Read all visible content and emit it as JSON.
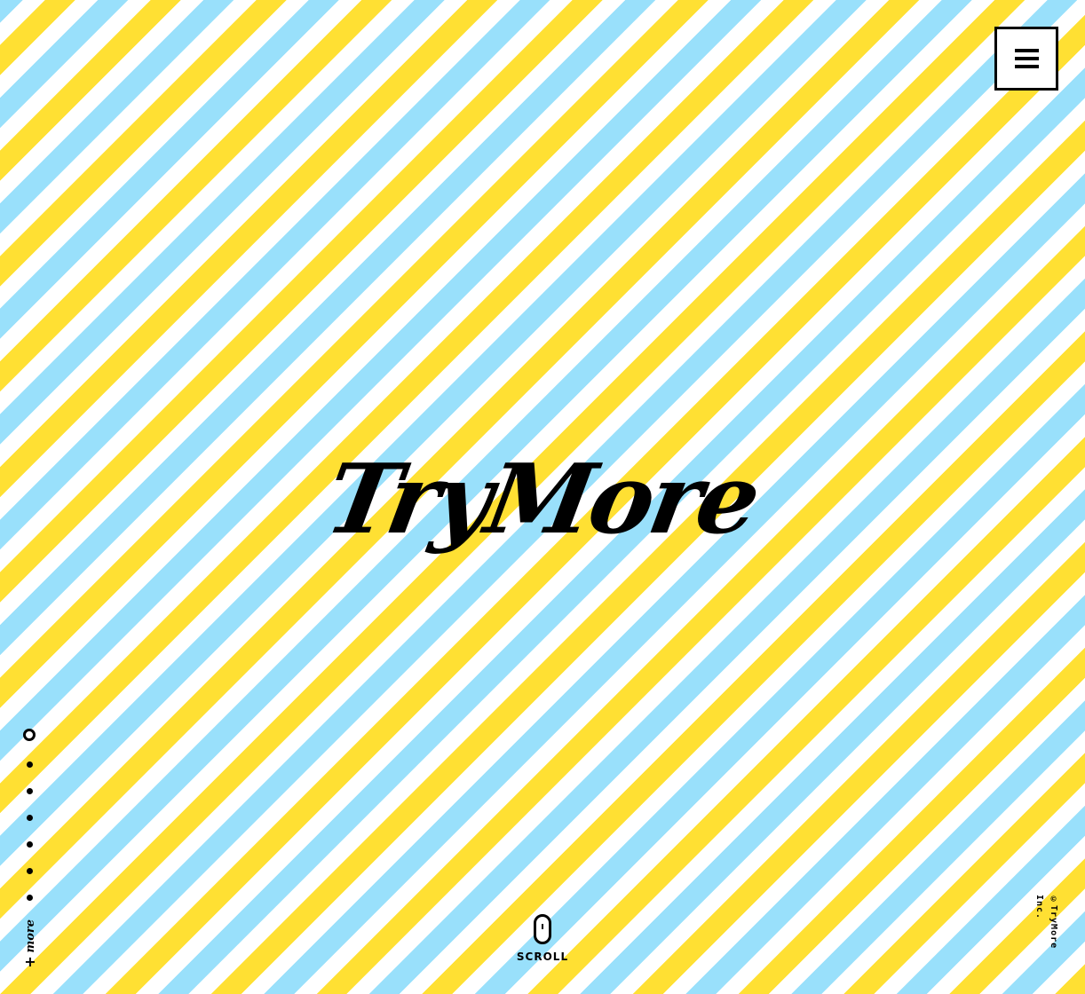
{
  "header": {
    "menu_icon": "hamburger-menu-icon"
  },
  "hero": {
    "logo_text": "TryMore",
    "colors": {
      "stripe_yellow": "#ffe033",
      "stripe_blue": "#99e0fb",
      "stripe_white": "#ffffff"
    }
  },
  "section_nav": {
    "count": 7,
    "active_index": 0
  },
  "more_link": {
    "label": "more",
    "icon": "plus-icon",
    "plus": "+"
  },
  "scroll": {
    "icon": "mouse-icon",
    "label": "SCROLL"
  },
  "footer": {
    "copyright": "©TryMore Inc."
  }
}
